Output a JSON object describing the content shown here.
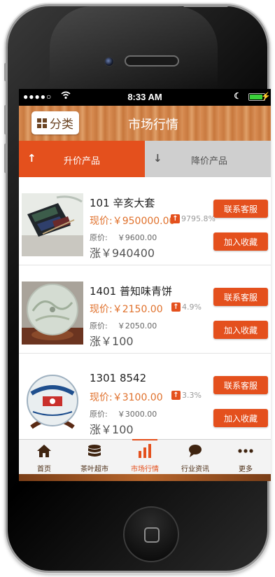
{
  "status_bar": {
    "signal": "●●●●○",
    "time": "8:33 AM"
  },
  "header": {
    "category_label": "分类",
    "title": "市场行情"
  },
  "tabs": [
    {
      "label": "升价产品",
      "active": true,
      "arrow": "↑"
    },
    {
      "label": "降价产品",
      "active": false,
      "arrow": "↓"
    }
  ],
  "labels": {
    "current_price": "现价:",
    "original_price": "原价:",
    "rise": "涨",
    "contact_button": "联系客服",
    "favorite_button": "加入收藏"
  },
  "products": [
    {
      "name": "101 辛亥大套",
      "current_price": "￥950000.00",
      "change_pct": "9795.8%",
      "original_price": "￥9600.00",
      "rise_amount": "￥940400"
    },
    {
      "name": "1401 普知味青饼",
      "current_price": "￥2150.00",
      "change_pct": "4.9%",
      "original_price": "￥2050.00",
      "rise_amount": "￥100"
    },
    {
      "name": "1301 8542",
      "current_price": "￥3100.00",
      "change_pct": "3.3%",
      "original_price": "￥3000.00",
      "rise_amount": "￥100"
    }
  ],
  "bottom_nav": [
    {
      "label": "首页",
      "icon": "home-icon",
      "active": false
    },
    {
      "label": "茶叶超市",
      "icon": "database-icon",
      "active": false
    },
    {
      "label": "市场行情",
      "icon": "bar-chart-icon",
      "active": true
    },
    {
      "label": "行业资讯",
      "icon": "chat-bubble-icon",
      "active": false
    },
    {
      "label": "更多",
      "icon": "more-dots-icon",
      "active": false
    }
  ],
  "colors": {
    "accent": "#e4501d",
    "price": "#e0712c",
    "tab_inactive": "#cfcfcf"
  }
}
